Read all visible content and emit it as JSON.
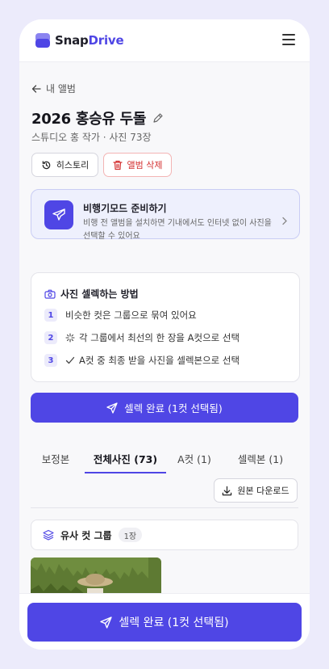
{
  "header": {
    "logo_part1": "Snap",
    "logo_part2": "Drive",
    "menu_icon": "hamburger-menu-icon"
  },
  "nav": {
    "back_label": "내 앨범"
  },
  "album": {
    "title": "2026 홍승유 두돌",
    "subtitle": "스튜디오 홍 작가 · 사진 73장"
  },
  "actions": {
    "history_label": "히스토리",
    "delete_label": "앨범 삭제"
  },
  "airplane_mode": {
    "title": "비행기모드 준비하기",
    "description": "비행 전 앨범을 설치하면 기내에서도 인터넷 없이 사진을 선택할 수 있어요"
  },
  "howto": {
    "title": "사진 셀렉하는 방법",
    "steps": [
      {
        "num": "1",
        "text": "비슷한 컷은 그룹으로 묶여 있어요"
      },
      {
        "num": "2",
        "text": "각 그룹에서 최선의 한 장을 A컷으로 선택"
      },
      {
        "num": "3",
        "text": "A컷 중 최종 받을 사진을 셀렉본으로 선택"
      }
    ]
  },
  "primary_button": "셀렉 완료 (1컷 선택됨)",
  "tabs": [
    {
      "label": "보정본"
    },
    {
      "label": "전체사진 (73)"
    },
    {
      "label": "A컷 (1)"
    },
    {
      "label": "셀렉본 (1)"
    }
  ],
  "active_tab": "전체사진 (73)",
  "download_label": "원본 다운로드",
  "group": {
    "label": "유사 컷 그룹",
    "count": "1장"
  },
  "bottom_button": "셀렉 완료 (1컷 선택됨)",
  "colors": {
    "accent": "#4F46E5",
    "danger": "#D32F2F",
    "background": "#ECEBFB"
  }
}
